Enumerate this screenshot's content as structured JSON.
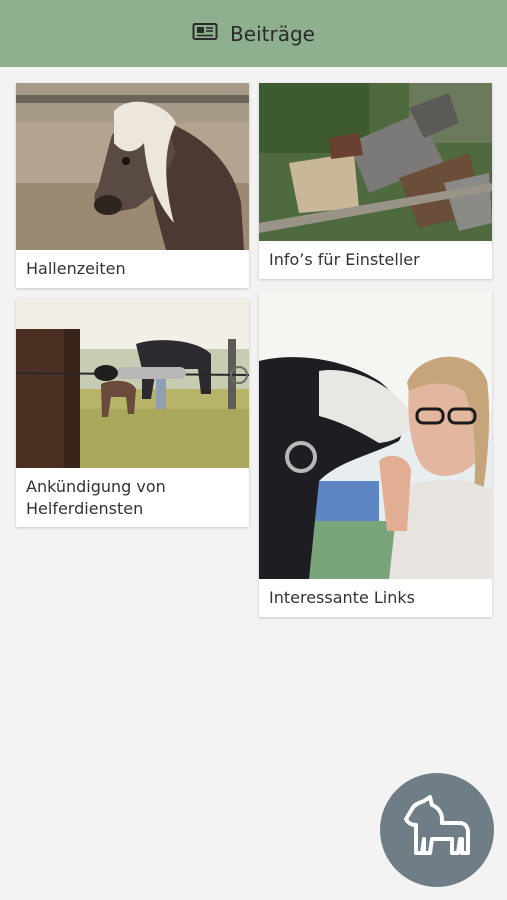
{
  "header": {
    "title": "Beiträge",
    "icon": "newspaper-icon"
  },
  "cards": [
    {
      "label": "Hallenzeiten"
    },
    {
      "label": "Info’s für Einsteller"
    },
    {
      "label": "Ankündigung von Helferdiensten"
    },
    {
      "label": "Interessante Links"
    }
  ],
  "fab": {
    "icon": "horse-icon"
  },
  "colors": {
    "header_bg": "#8fb08f",
    "background": "#f3f3f3",
    "fab_bg": "#6f7d86"
  }
}
